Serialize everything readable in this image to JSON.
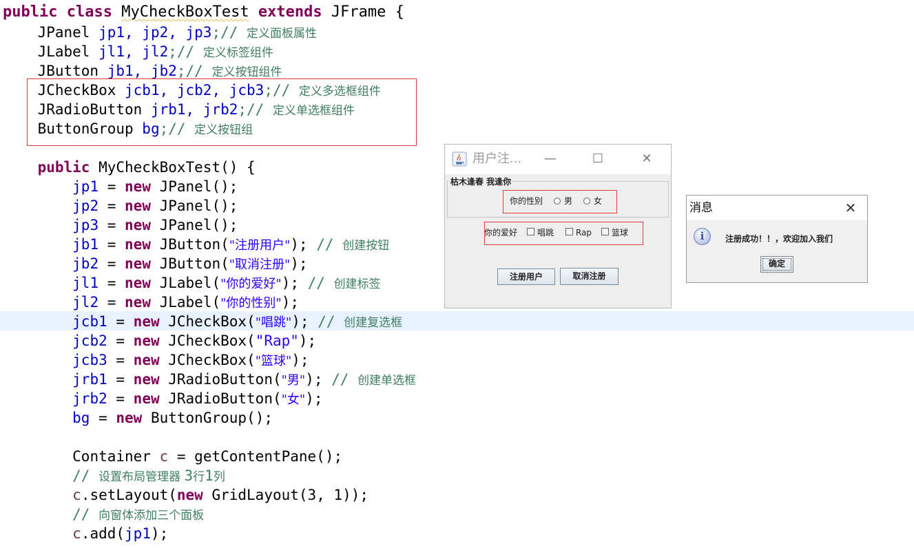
{
  "code": {
    "l1": {
      "kw1": "public",
      "kw2": "class",
      "name": "MyCheckBoxTest",
      "kw3": "extends",
      "sup": "JFrame {"
    },
    "l2": {
      "type": "JPanel ",
      "vars": "jp1, jp2, jp3",
      "comment_slashes": ";// ",
      "comment": "定义面板属性"
    },
    "l3": {
      "type": "JLabel ",
      "vars": "jl1, jl2",
      "comment_slashes": ";// ",
      "comment": "定义标签组件"
    },
    "l4": {
      "type": "JButton ",
      "vars": "jb1, jb2",
      "comment_slashes": ";// ",
      "comment": "定义按钮组件"
    },
    "l5": {
      "type": "JCheckBox ",
      "vars": "jcb1, jcb2, jcb3",
      "comment_slashes": ";// ",
      "comment": "定义多选框组件"
    },
    "l6": {
      "type": "JRadioButton ",
      "vars": "jrb1, jrb2",
      "comment_slashes": ";// ",
      "comment": "定义单选框组件"
    },
    "l7": {
      "type": "ButtonGroup ",
      "vars": "bg",
      "comment_slashes": ";// ",
      "comment": "定义按钮组"
    },
    "l8": {
      "kw": "public",
      "sig": " MyCheckBoxTest() {"
    },
    "l9": {
      "var": "jp1",
      "op": " = ",
      "kw": "new",
      "call": " JPanel();"
    },
    "l10": {
      "var": "jp2",
      "op": " = ",
      "kw": "new",
      "call": " JPanel();"
    },
    "l11": {
      "var": "jp3",
      "op": " = ",
      "kw": "new",
      "call": " JPanel();"
    },
    "l12": {
      "var": "jb1",
      "op": " = ",
      "kw": "new",
      "call": " JButton(",
      "str": "\"注册用户\"",
      "end": "); ",
      "cslash": "// ",
      "comment": "创建按钮"
    },
    "l13": {
      "var": "jb2",
      "op": " = ",
      "kw": "new",
      "call": " JButton(",
      "str": "\"取消注册\"",
      "end": ");"
    },
    "l14": {
      "var": "jl1",
      "op": " = ",
      "kw": "new",
      "call": " JLabel(",
      "str": "\"你的爱好\"",
      "end": "); ",
      "cslash": "// ",
      "comment": "创建标签"
    },
    "l15": {
      "var": "jl2",
      "op": " = ",
      "kw": "new",
      "call": " JLabel(",
      "str": "\"你的性别\"",
      "end": ");"
    },
    "l16": {
      "var": "jcb1",
      "op": " = ",
      "kw": "new",
      "call": " JCheckBox(",
      "str": "\"唱跳\"",
      "end": "); ",
      "cslash": "// ",
      "comment": "创建复选框"
    },
    "l17": {
      "var": "jcb2",
      "op": " = ",
      "kw": "new",
      "call": " JCheckBox(",
      "str": "\"Rap\"",
      "end": ");"
    },
    "l18": {
      "var": "jcb3",
      "op": " = ",
      "kw": "new",
      "call": " JCheckBox(",
      "str": "\"篮球\"",
      "end": ");"
    },
    "l19": {
      "var": "jrb1",
      "op": " = ",
      "kw": "new",
      "call": " JRadioButton(",
      "str": "\"男\"",
      "end": "); ",
      "cslash": "// ",
      "comment": "创建单选框"
    },
    "l20": {
      "var": "jrb2",
      "op": " = ",
      "kw": "new",
      "call": " JRadioButton(",
      "str": "\"女\"",
      "end": ");"
    },
    "l21": {
      "var": "bg",
      "op": " = ",
      "kw": "new",
      "call": " ButtonGroup();"
    },
    "l22": {
      "type": "Container ",
      "var": "c",
      "rest": " = getContentPane();"
    },
    "l23": {
      "cslash": "// ",
      "comment": "设置布局管理器 ",
      "n1": "3",
      "t1": "行",
      "n2": "1",
      "t2": "列"
    },
    "l24": {
      "var": "c",
      "pre": ".setLayout(",
      "kw": "new",
      "rest": " GridLayout(3, 1));"
    },
    "l25": {
      "cslash": "// ",
      "comment": "向窗体添加三个面板"
    },
    "l26": {
      "var": "c",
      "rest": ".add(",
      "arg": "jp1",
      "end": ");"
    }
  },
  "frame": {
    "title": "用户注...",
    "minimize_glyph": "—",
    "maximize_glyph": "☐",
    "close_glyph": "✕",
    "group_title": "枯木逢春 我逢你",
    "gender_label": "你的性别",
    "radio_male": "男",
    "radio_female": "女",
    "hobby_label": "你的爱好",
    "check_sing": "唱跳",
    "check_rap": "Rap",
    "check_ball": "篮球",
    "register_button": "注册用户",
    "cancel_button": "取消注册"
  },
  "dialog": {
    "title": "消息",
    "close_glyph": "✕",
    "info_glyph": "i",
    "message": "注册成功！！，欢迎加入我们",
    "ok_button": "确定"
  },
  "colors": {
    "keyword": "#7f0055",
    "field": "#0000c0",
    "string": "#2a00ff",
    "comment": "#3f7f5f",
    "highlight": "#e8f2fe",
    "annotation_box": "#e0393e"
  }
}
